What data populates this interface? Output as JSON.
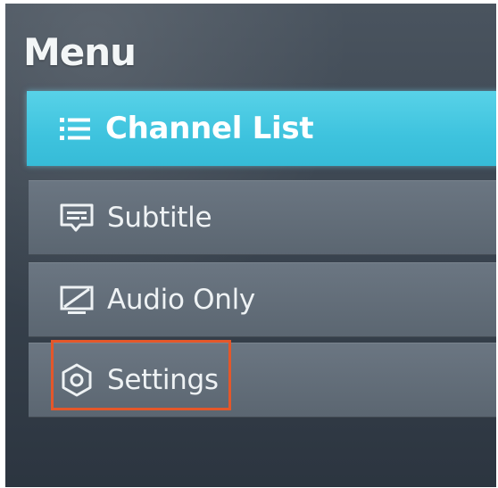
{
  "menu": {
    "title": "Menu",
    "items": [
      {
        "label": "Channel List",
        "icon": "list-icon",
        "selected": true
      },
      {
        "label": "Subtitle",
        "icon": "subtitle-icon",
        "selected": false
      },
      {
        "label": "Audio Only",
        "icon": "audio-only-icon",
        "selected": false
      },
      {
        "label": "Settings",
        "icon": "gear-icon",
        "selected": false
      }
    ]
  },
  "colors": {
    "selected_bg": "#3ec3de",
    "item_bg": "#616c77",
    "highlight": "#e4572a",
    "text": "#eef2f4"
  }
}
